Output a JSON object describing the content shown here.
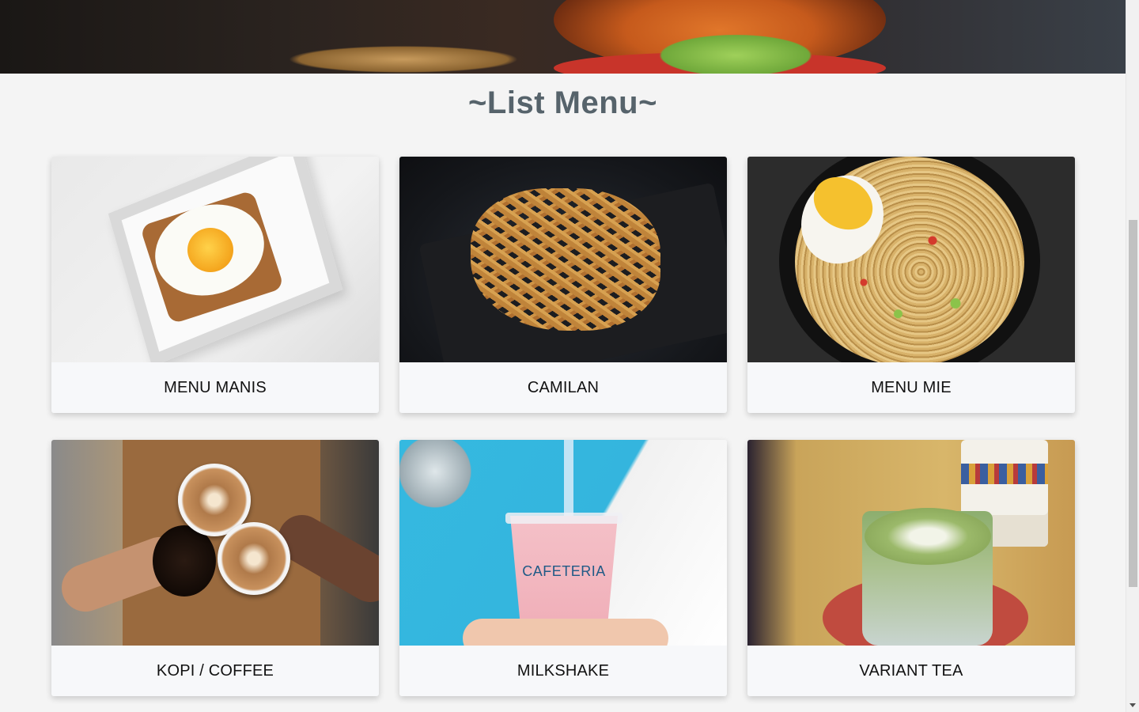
{
  "page": {
    "title": "~List Menu~"
  },
  "menu": {
    "items": [
      {
        "label": "MENU MANIS",
        "image": "egg-toast-image"
      },
      {
        "label": "CAMILAN",
        "image": "french-fries-image"
      },
      {
        "label": "MENU MIE",
        "image": "noodle-bowl-image"
      },
      {
        "label": "KOPI / COFFEE",
        "image": "coffee-cups-image"
      },
      {
        "label": "MILKSHAKE",
        "image": "milkshake-image",
        "brand_text": "CAFETERIA"
      },
      {
        "label": "VARIANT TEA",
        "image": "matcha-latte-image"
      }
    ]
  },
  "colors": {
    "background": "#f4f4f4",
    "title": "#56636b",
    "card": "#f7f8fa",
    "label": "#111111"
  }
}
